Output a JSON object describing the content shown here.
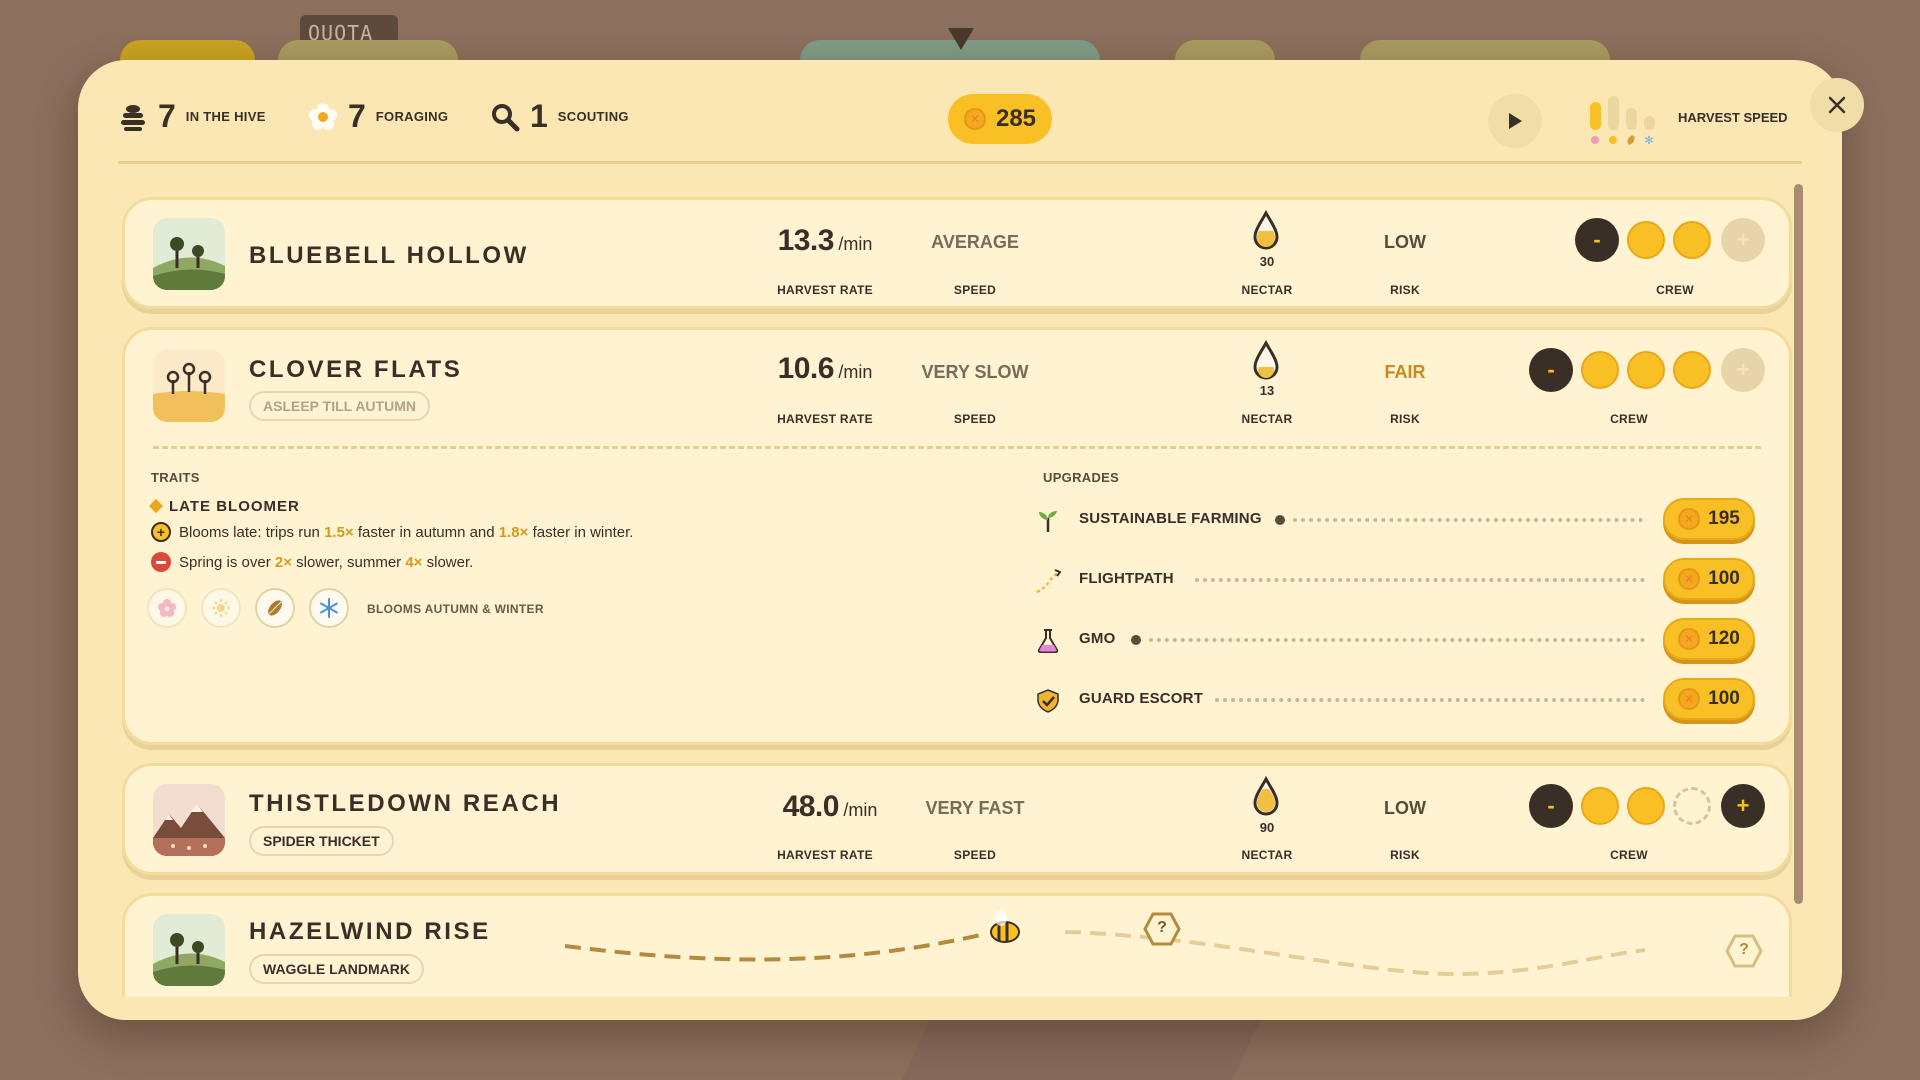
{
  "background": {
    "quota_label": "QUOTA"
  },
  "header": {
    "hive": {
      "count": "7",
      "label": "IN THE HIVE",
      "icon": "beehive-icon"
    },
    "foraging": {
      "count": "7",
      "label": "FORAGING",
      "icon": "flower-icon"
    },
    "scouting": {
      "count": "1",
      "label": "SCOUTING",
      "icon": "magnifier-icon"
    },
    "coins": "285",
    "harvest_speed_label": "HARVEST SPEED",
    "harvest_speed_level": 1
  },
  "colors": {
    "panel": "#fae7b4",
    "card": "#fff3d2",
    "honey": "#f8c024",
    "dark": "#3a2f27",
    "accent_warn": "#c88a1e"
  },
  "sites": [
    {
      "name": "BLUEBELL HOLLOW",
      "tag": "",
      "harvest_rate": "13.3",
      "rate_unit": "/min",
      "harvest_rate_label": "HARVEST RATE",
      "speed": "AVERAGE",
      "speed_label": "SPEED",
      "nectar": "30",
      "nectar_label": "NECTAR",
      "risk": "LOW",
      "risk_label": "RISK",
      "crew_label": "CREW",
      "crew_minus": "-",
      "crew_plus": "+",
      "crew_assigned": 2,
      "crew_slots": 2
    },
    {
      "name": "CLOVER FLATS",
      "tag": "ASLEEP TILL AUTUMN",
      "harvest_rate": "10.6",
      "rate_unit": "/min",
      "harvest_rate_label": "HARVEST RATE",
      "speed": "VERY SLOW",
      "speed_label": "SPEED",
      "nectar": "13",
      "nectar_label": "NECTAR",
      "risk": "FAIR",
      "risk_label": "RISK",
      "crew_label": "CREW",
      "crew_minus": "-",
      "crew_plus": "+",
      "crew_assigned": 3,
      "crew_slots": 3,
      "traits_title": "TRAITS",
      "trait": {
        "name": "LATE BLOOMER",
        "pro": {
          "a": "Blooms late: trips run ",
          "b": "1.5×",
          "c": " faster in autumn and ",
          "d": "1.8×",
          "e": " faster in winter."
        },
        "con": {
          "a": "Spring is over ",
          "b": "2×",
          "c": " slower, summer ",
          "d": "4×",
          "e": " slower."
        },
        "blooms_label": "BLOOMS AUTUMN & WINTER"
      },
      "upgrades_title": "UPGRADES",
      "upgrades": [
        {
          "name": "SUSTAINABLE FARMING",
          "cost": "195",
          "icon": "sprout-icon"
        },
        {
          "name": "FLIGHTPATH",
          "cost": "100",
          "icon": "flightpath-icon"
        },
        {
          "name": "GMO",
          "cost": "120",
          "icon": "flask-icon"
        },
        {
          "name": "GUARD ESCORT",
          "cost": "100",
          "icon": "shield-icon"
        }
      ]
    },
    {
      "name": "THISTLEDOWN REACH",
      "tag": "SPIDER THICKET",
      "harvest_rate": "48.0",
      "rate_unit": "/min",
      "harvest_rate_label": "HARVEST RATE",
      "speed": "VERY FAST",
      "speed_label": "SPEED",
      "nectar": "90",
      "nectar_label": "NECTAR",
      "risk": "LOW",
      "risk_label": "RISK",
      "crew_label": "CREW",
      "crew_minus": "-",
      "crew_plus": "+",
      "crew_assigned": 2,
      "crew_slots": 3
    },
    {
      "name": "HAZELWIND RISE",
      "tag": "WAGGLE LANDMARK",
      "unknown_marker": "?"
    }
  ]
}
